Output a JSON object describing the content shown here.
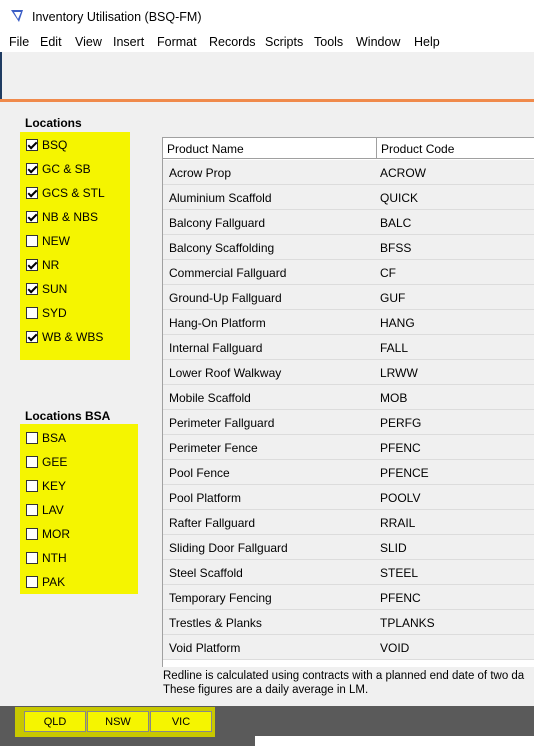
{
  "window": {
    "title": "Inventory Utilisation (BSQ-FM)",
    "icon": "app-icon"
  },
  "menu": [
    "File",
    "Edit",
    "View",
    "Insert",
    "Format",
    "Records",
    "Scripts",
    "Tools",
    "Window",
    "Help"
  ],
  "locations": {
    "label": "Locations",
    "items": [
      {
        "label": "BSQ",
        "checked": true
      },
      {
        "label": "GC & SB",
        "checked": true
      },
      {
        "label": "GCS & STL",
        "checked": true
      },
      {
        "label": "NB & NBS",
        "checked": true
      },
      {
        "label": "NEW",
        "checked": false
      },
      {
        "label": "NR",
        "checked": true
      },
      {
        "label": "SUN",
        "checked": true
      },
      {
        "label": "SYD",
        "checked": false
      },
      {
        "label": "WB & WBS",
        "checked": true
      }
    ]
  },
  "locations_bsa": {
    "label": "Locations BSA",
    "items": [
      {
        "label": "BSA",
        "checked": false
      },
      {
        "label": "GEE",
        "checked": false
      },
      {
        "label": "KEY",
        "checked": false
      },
      {
        "label": "LAV",
        "checked": false
      },
      {
        "label": "MOR",
        "checked": false
      },
      {
        "label": "NTH",
        "checked": false
      },
      {
        "label": "PAK",
        "checked": false
      }
    ]
  },
  "table": {
    "headers": [
      "Product Name",
      "Product Code"
    ],
    "rows": [
      [
        "Acrow Prop",
        "ACROW"
      ],
      [
        "Aluminium Scaffold",
        "QUICK"
      ],
      [
        "Balcony Fallguard",
        "BALC"
      ],
      [
        "Balcony Scaffolding",
        "BFSS"
      ],
      [
        "Commercial Fallguard",
        "CF"
      ],
      [
        "Ground-Up Fallguard",
        "GUF"
      ],
      [
        "Hang-On Platform",
        "HANG"
      ],
      [
        "Internal Fallguard",
        "FALL"
      ],
      [
        "Lower Roof Walkway",
        "LRWW"
      ],
      [
        "Mobile Scaffold",
        "MOB"
      ],
      [
        "Perimeter Fallguard",
        "PERFG"
      ],
      [
        "Perimeter Fence",
        "PFENC"
      ],
      [
        "Pool Fence",
        "PFENCE"
      ],
      [
        "Pool Platform",
        "POOLV"
      ],
      [
        "Rafter Fallguard",
        "RRAIL"
      ],
      [
        "Sliding Door Fallguard",
        "SLID"
      ],
      [
        "Steel Scaffold",
        "STEEL"
      ],
      [
        "Temporary Fencing",
        "PFENC"
      ],
      [
        "Trestles & Planks",
        "TPLANKS"
      ],
      [
        "Void Platform",
        "VOID"
      ]
    ]
  },
  "note": {
    "line1": "Redline is calculated using contracts with a planned end date of two da",
    "line2": "These figures are a daily average in LM."
  },
  "buttons": [
    "QLD",
    "NSW",
    "VIC"
  ],
  "colors": {
    "highlight": "#f5f500",
    "accent": "#f08a4b"
  }
}
